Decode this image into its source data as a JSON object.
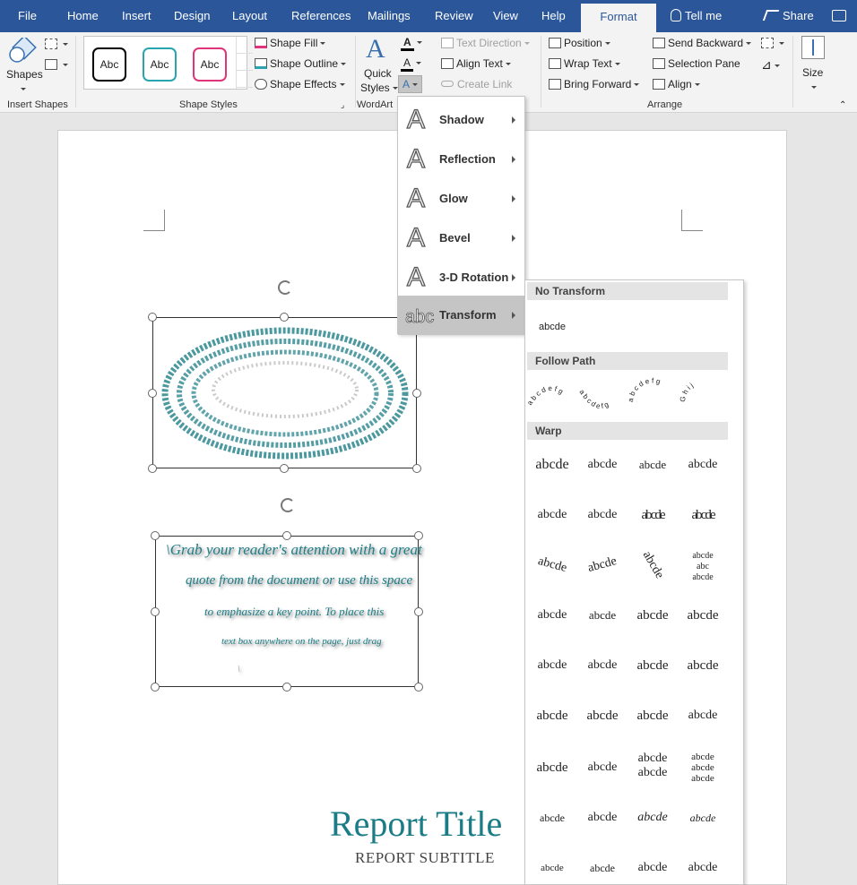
{
  "tabs": [
    "File",
    "Home",
    "Insert",
    "Design",
    "Layout",
    "References",
    "Mailings",
    "Review",
    "View",
    "Help",
    "Format"
  ],
  "tellme": "Tell me",
  "share": "Share",
  "ribbon": {
    "insert_shapes": {
      "shapes_label": "Shapes",
      "group": "Insert Shapes"
    },
    "shape_styles": {
      "samples": [
        "Abc",
        "Abc",
        "Abc"
      ],
      "sample_colors": [
        "#000000",
        "#2aa5b0",
        "#e0357d"
      ],
      "fill": "Shape Fill",
      "outline": "Shape Outline",
      "effects": "Shape Effects",
      "group": "Shape Styles"
    },
    "wordart": {
      "quick": "Quick",
      "styles": "Styles",
      "group": "WordArt"
    },
    "text": {
      "direction": "Text Direction",
      "align": "Align Text",
      "link": "Create Link"
    },
    "arrange": {
      "position": "Position",
      "wrap": "Wrap Text",
      "bring": "Bring Forward",
      "send": "Send Backward",
      "pane": "Selection Pane",
      "align": "Align",
      "group": "Arrange"
    },
    "size": {
      "label": "Size"
    }
  },
  "effects_menu": [
    {
      "label": "Shadow"
    },
    {
      "label": "Reflection"
    },
    {
      "label": "Glow"
    },
    {
      "label": "Bevel"
    },
    {
      "label": "3-D Rotation"
    },
    {
      "label": "Transform"
    }
  ],
  "transform_gallery": {
    "no_transform": {
      "header": "No Transform",
      "sample": "abcde"
    },
    "follow_path": {
      "header": "Follow Path",
      "samples": [
        "a b c d e f g",
        "a b c d e f g",
        "a b c d e f g",
        "G h i j"
      ]
    },
    "warp": {
      "header": "Warp",
      "sample": "abcde",
      "stacked": [
        "abcde",
        "abc",
        "abcde"
      ]
    }
  },
  "document": {
    "quote_lines": [
      "\\Grab your reader's attention with a great",
      "quote from the document or use this space",
      "to emphasize a key point. To place this",
      "text box anywhere on the page, just drag"
    ],
    "title": "Report Title",
    "subtitle": "REPORT SUBTITLE"
  }
}
